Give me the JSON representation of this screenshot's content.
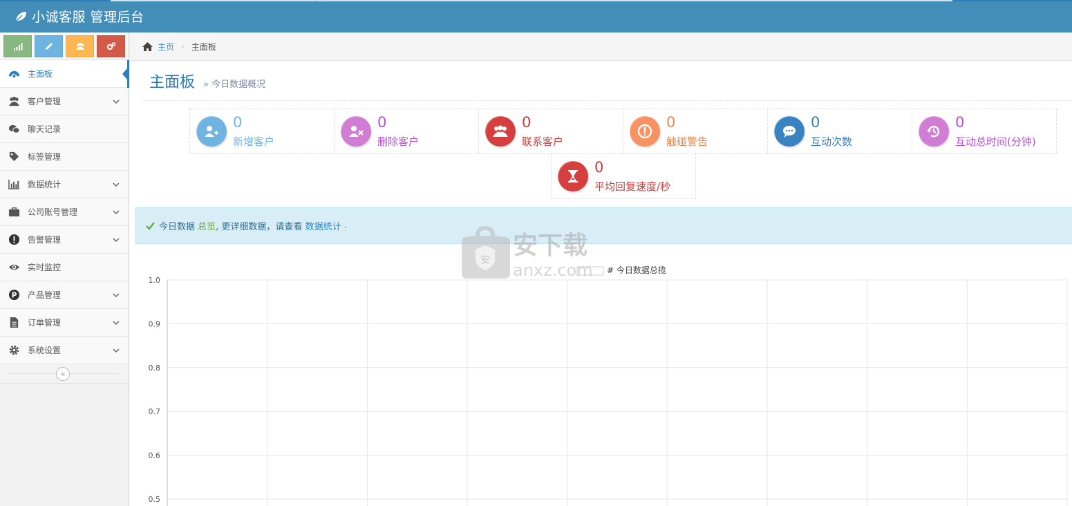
{
  "navbar": {
    "brand": "小诚客服 管理后台"
  },
  "shortcuts": [
    {
      "icon": "signal-icon",
      "color": "#87b87f"
    },
    {
      "icon": "pencil-icon",
      "color": "#6fb3e0"
    },
    {
      "icon": "users-icon",
      "color": "#ffb752"
    },
    {
      "icon": "cogs-icon",
      "color": "#d15b47"
    }
  ],
  "sidebar": {
    "items": [
      {
        "label": "主面板",
        "icon": "dashboard-icon",
        "active": true,
        "submenu": false
      },
      {
        "label": "客户管理",
        "icon": "users-icon",
        "submenu": true
      },
      {
        "label": "聊天记录",
        "icon": "wechat-icon",
        "submenu": false
      },
      {
        "label": "标签管理",
        "icon": "tag-icon",
        "submenu": false
      },
      {
        "label": "数据统计",
        "icon": "bar-chart-icon",
        "submenu": true
      },
      {
        "label": "公司账号管理",
        "icon": "briefcase-icon",
        "submenu": true
      },
      {
        "label": "告警管理",
        "icon": "exclamation-icon",
        "submenu": true
      },
      {
        "label": "实时监控",
        "icon": "eye-icon",
        "submenu": false
      },
      {
        "label": "产品管理",
        "icon": "product-icon",
        "submenu": true
      },
      {
        "label": "订单管理",
        "icon": "file-icon",
        "submenu": true
      },
      {
        "label": "系统设置",
        "icon": "gear-icon",
        "submenu": true
      }
    ],
    "collapse_glyph": "«"
  },
  "breadcrumb": {
    "home": "主页",
    "current": "主面板"
  },
  "page_header": {
    "title": "主面板",
    "subtitle": "» 今日数据概况"
  },
  "infoboxes": [
    {
      "value": "0",
      "label": "新增客户",
      "icon": "user-plus-icon",
      "color": "#6fb3e0",
      "text_color": "#6fb3e0"
    },
    {
      "value": "0",
      "label": "删除客户",
      "icon": "user-times-icon",
      "color": "#d6487e",
      "text_color": "#b74ed7"
    },
    {
      "value": "0",
      "label": "联系客户",
      "icon": "users-icon",
      "color": "#d53f40",
      "text_color": "#c73d3d"
    },
    {
      "value": "0",
      "label": "触碰警告",
      "icon": "exclamation-icon",
      "color": "#f79263",
      "text_color": "#e8864e"
    },
    {
      "value": "0",
      "label": "互动次数",
      "icon": "comments-icon",
      "color": "#3983c2",
      "text_color": "#3a7bbf"
    },
    {
      "value": "0",
      "label": "互动总时间(分钟)",
      "icon": "history-icon",
      "color": "#c75ecf",
      "text_color": "#b74ed7"
    },
    {
      "value": "0",
      "label": "平均回复速度/秒",
      "icon": "hourglass-icon",
      "color": "#d53f40",
      "text_color": "#c73d3d"
    }
  ],
  "alert": {
    "prefix": "今日数据",
    "link1": "总览",
    "middle": ", 更详细数据，请查看",
    "link2": "数据统计",
    "suffix": "."
  },
  "chart_data": {
    "type": "line",
    "title": "# 今日数据总揽",
    "ylim": [
      0.5,
      1.0
    ],
    "yticks": [
      "1.0",
      "0.9",
      "0.8",
      "0.7",
      "0.6",
      "0.5"
    ],
    "series": [],
    "grid": true
  },
  "watermark": {
    "text": "安下载",
    "domain": "anxz.com"
  }
}
